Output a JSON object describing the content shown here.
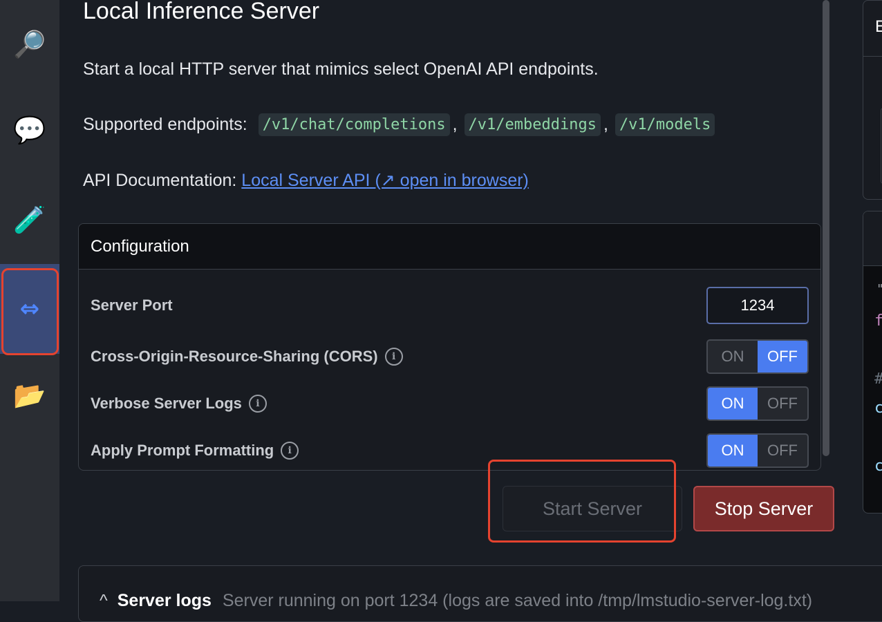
{
  "sidebar": {
    "items": [
      {
        "id": "search",
        "icon": "🔎"
      },
      {
        "id": "chat",
        "icon": "💬"
      },
      {
        "id": "lab",
        "icon": "🧪"
      },
      {
        "id": "server",
        "icon": "⇔"
      },
      {
        "id": "models",
        "icon": "📂"
      }
    ]
  },
  "header": {
    "title": "Local Inference Server",
    "description": "Start a local HTTP server that mimics select OpenAI API endpoints.",
    "endpoints_label": "Supported endpoints:",
    "endpoints": [
      "/v1/chat/completions",
      "/v1/embeddings",
      "/v1/models"
    ],
    "endpoint_separator": ",",
    "api_doc_label": "API Documentation:",
    "api_doc_link": "Local Server API (↗ open in browser)"
  },
  "config": {
    "title": "Configuration",
    "port_label": "Server Port",
    "port_value": "1234",
    "cors_label": "Cross-Origin-Resource-Sharing (CORS)",
    "cors_state": "OFF",
    "verbose_label": "Verbose Server Logs",
    "verbose_state": "ON",
    "prompt_label": "Apply Prompt Formatting",
    "prompt_state": "ON",
    "on_label": "ON",
    "off_label": "OFF",
    "info_glyph": "i"
  },
  "actions": {
    "start_label": "Start Server",
    "stop_label": "Stop Server"
  },
  "logs": {
    "caret": "^",
    "title": "Server logs",
    "status": "Server running on port 1234 (logs are saved into /tmp/lmstudio-server-log.txt)"
  },
  "right": {
    "panel1_letter": "E",
    "code_chars": [
      "\"",
      "f",
      "#",
      "c",
      "c"
    ]
  },
  "colors": {
    "accent": "#4a7cf0",
    "highlight": "#e5432f",
    "stop": "#7a2b2b",
    "code": "#8fd6a6",
    "link": "#5d8ff5"
  }
}
